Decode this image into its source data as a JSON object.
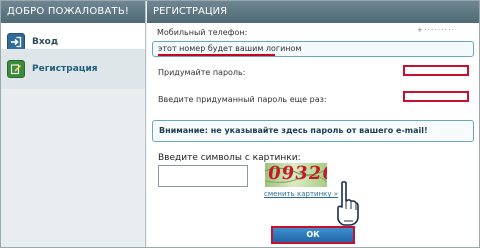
{
  "left_panel": {
    "title": "ДОБРО ПОЖАЛОВАТЬ!",
    "items": [
      {
        "label": "Вход",
        "icon": "login-arrow-icon"
      },
      {
        "label": "Регистрация",
        "icon": "edit-form-icon"
      }
    ]
  },
  "registration": {
    "title": "РЕГИСТРАЦИЯ",
    "phone_label": "Мобильный телефон:",
    "phone_value": "+ · · · · · · · · ·",
    "phone_hint": "этот номер будет вашим логином",
    "password_label": "Придумайте пароль:",
    "password_value": "",
    "password_repeat_label": "Введите придуманный пароль еще раз:",
    "password_repeat_value": "",
    "warning": "Внимание: не указывайте здесь пароль от вашего e-mail!",
    "captcha_label": "Введите символы с картинки:",
    "captcha_value": "",
    "captcha_code": "09326",
    "captcha_refresh": "сменить картинку »",
    "submit_label": "ОК"
  },
  "colors": {
    "header": "#58717d",
    "highlight_red": "#c8102e",
    "button_blue": "#2f79bb",
    "hint_border": "#6aa6c2"
  }
}
